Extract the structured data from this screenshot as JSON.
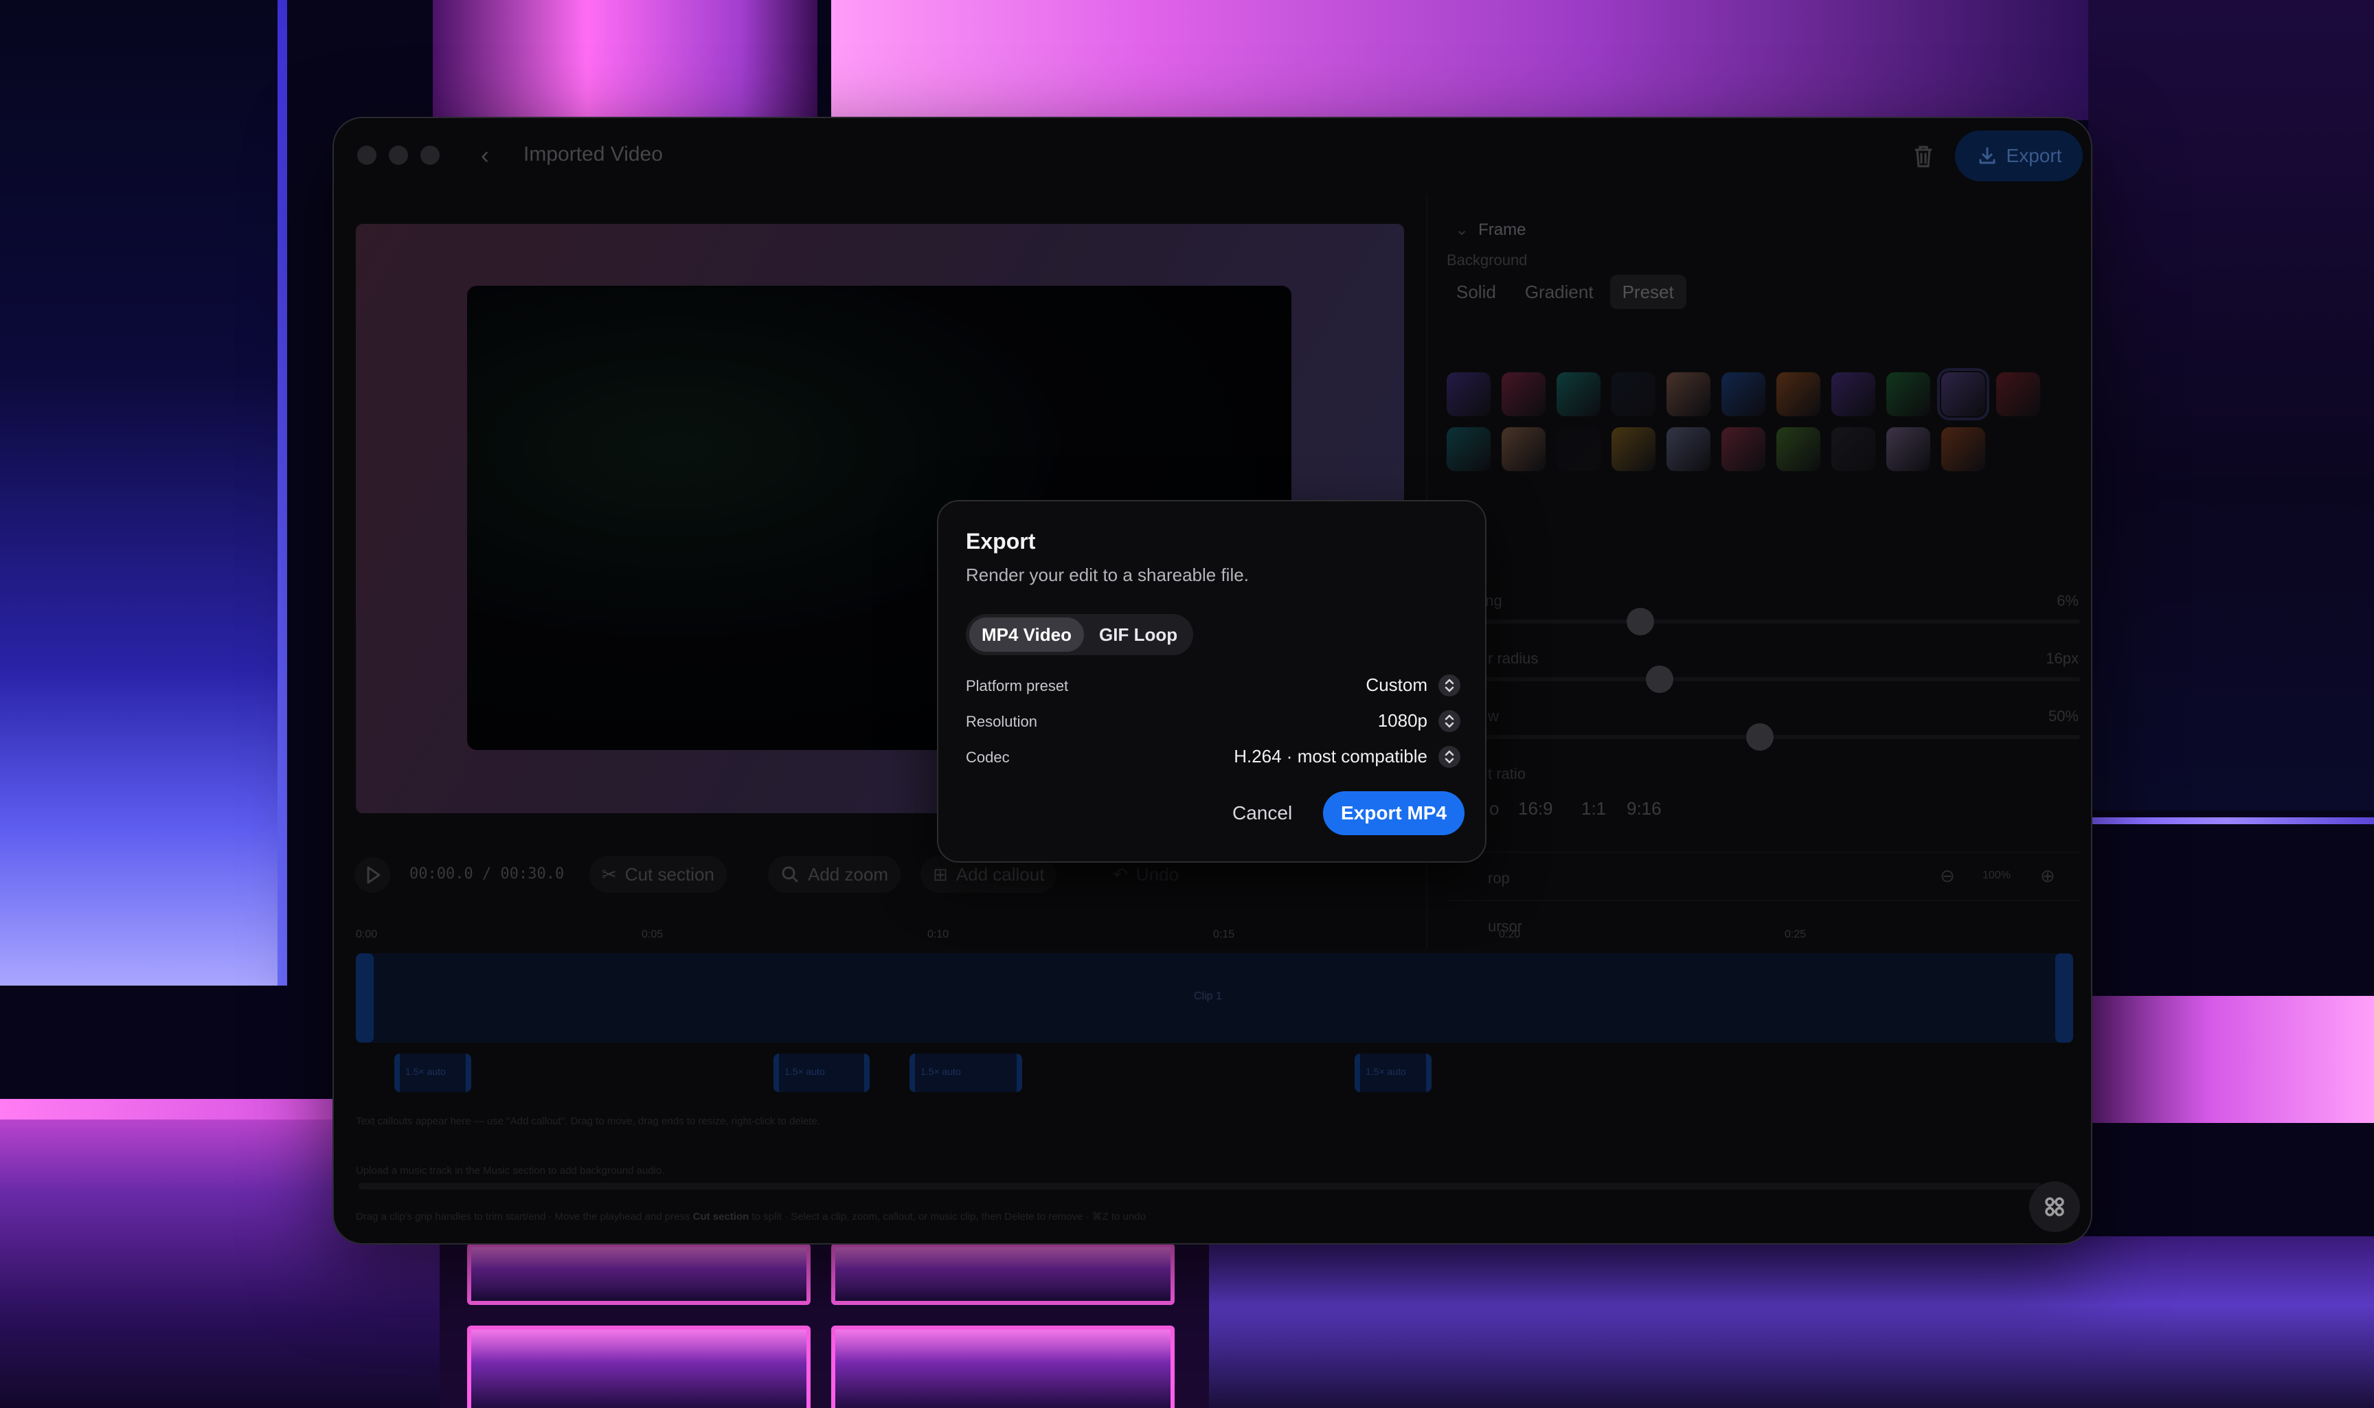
{
  "window": {
    "title": "Imported Video",
    "export_label": "Export"
  },
  "panel": {
    "section_title": "Frame",
    "background_label": "Background",
    "background_tabs": [
      "Solid",
      "Gradient",
      "Preset"
    ],
    "active_background_tab": "Preset",
    "swatch_colors": [
      "#6d4bd8",
      "#d83a6a",
      "#1fb6b0",
      "#1e2740",
      "#e29a7a",
      "#2a6ee8",
      "#f07a2a",
      "#7a4ae0",
      "#2aa84a",
      "#8a6ad8",
      "#c0303a",
      "#1a9aa8",
      "#e8a072",
      "#14141c",
      "#e0a52a",
      "#a0a8e0",
      "#e04a6a",
      "#6ab83a",
      "#3a3a44",
      "#c0a0e0",
      "#e8682a"
    ],
    "selected_swatch": 9,
    "padding_label": "Padding",
    "padding_value": "6%",
    "radius_label": "r radius",
    "radius_value": "16px",
    "shadow_label": "w",
    "shadow_value": "50%",
    "ratio_label": "t ratio",
    "ratio_options": [
      "o",
      "16:9",
      "1:1",
      "9:16"
    ],
    "crop_label": "rop",
    "cursor_label": "ursor"
  },
  "toolbar": {
    "time_current": "00:00.0",
    "time_separator": "/",
    "time_total": "00:30.0",
    "cut_label": "Cut section",
    "zoom_label": "Add zoom",
    "callout_label": "Add callout",
    "undo_label": "Undo",
    "zoom_level": "100%"
  },
  "timeline": {
    "ticks": [
      "0:00",
      "0:05",
      "0:10",
      "0:15",
      "0:20",
      "0:25"
    ],
    "clip_label": "Clip 1",
    "zoom_chips": [
      "1.5× auto",
      "1.5× auto",
      "1.5× auto",
      "1.5× auto"
    ],
    "callout_hint": "Text callouts appear here — use \"Add callout\". Drag to move, drag ends to resize, right-click to delete.",
    "music_hint": "Upload a music track in the Music section to add background audio.",
    "footer_hint_a": "Drag a clip's grip handles to trim start/end · Move the playhead and press ",
    "footer_hint_cut": "Cut section",
    "footer_hint_b": " to split · Select a clip, zoom, callout, or music clip, then Delete to remove · ⌘Z to undo"
  },
  "modal": {
    "title": "Export",
    "subtitle": "Render your edit to a shareable file.",
    "formats": [
      "MP4 Video",
      "GIF Loop"
    ],
    "active_format": "MP4 Video",
    "options": [
      {
        "label": "Platform preset",
        "value": "Custom"
      },
      {
        "label": "Resolution",
        "value": "1080p"
      },
      {
        "label": "Codec",
        "value": "H.264 · most compatible"
      }
    ],
    "cancel_label": "Cancel",
    "export_label": "Export MP4"
  },
  "colors": {
    "accent": "#1a6ff0",
    "clip_handle": "#123a80"
  }
}
